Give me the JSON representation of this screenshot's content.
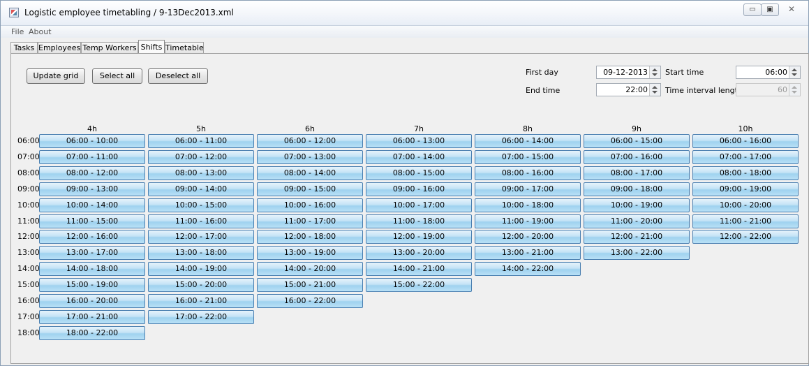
{
  "window": {
    "title": "Logistic employee timetabling / 9-13Dec2013.xml",
    "controls": {
      "minimize": "▭",
      "maximize": "▣",
      "close": "✕"
    }
  },
  "menu": {
    "file": "File",
    "about": "About"
  },
  "tabs": [
    {
      "label": "Tasks",
      "active": false
    },
    {
      "label": "Employees",
      "active": false
    },
    {
      "label": "Temp Workers",
      "active": false
    },
    {
      "label": "Shifts",
      "active": true
    },
    {
      "label": "Timetable",
      "active": false
    }
  ],
  "toolbar": {
    "update_grid": "Update grid",
    "select_all": "Select all",
    "deselect_all": "Deselect all"
  },
  "settings": {
    "first_day_label": "First day",
    "first_day_value": "09-12-2013",
    "start_time_label": "Start time",
    "start_time_value": "06:00",
    "end_time_label": "End time",
    "end_time_value": "22:00",
    "interval_label": "Time interval length",
    "interval_value": "60"
  },
  "grid": {
    "columns": [
      "4h",
      "5h",
      "6h",
      "7h",
      "8h",
      "9h",
      "10h"
    ],
    "rows": [
      "06:00",
      "07:00",
      "08:00",
      "09:00",
      "10:00",
      "11:00",
      "12:00",
      "13:00",
      "14:00",
      "15:00",
      "16:00",
      "17:00",
      "18:00"
    ],
    "cells": [
      [
        "06:00 - 10:00",
        "07:00 - 11:00",
        "08:00 - 12:00",
        "09:00 - 13:00",
        "10:00 - 14:00",
        "11:00 - 15:00",
        "12:00 - 16:00",
        "13:00 - 17:00",
        "14:00 - 18:00",
        "15:00 - 19:00",
        "16:00 - 20:00",
        "17:00 - 21:00",
        "18:00 - 22:00"
      ],
      [
        "06:00 - 11:00",
        "07:00 - 12:00",
        "08:00 - 13:00",
        "09:00 - 14:00",
        "10:00 - 15:00",
        "11:00 - 16:00",
        "12:00 - 17:00",
        "13:00 - 18:00",
        "14:00 - 19:00",
        "15:00 - 20:00",
        "16:00 - 21:00",
        "17:00 - 22:00"
      ],
      [
        "06:00 - 12:00",
        "07:00 - 13:00",
        "08:00 - 14:00",
        "09:00 - 15:00",
        "10:00 - 16:00",
        "11:00 - 17:00",
        "12:00 - 18:00",
        "13:00 - 19:00",
        "14:00 - 20:00",
        "15:00 - 21:00",
        "16:00 - 22:00"
      ],
      [
        "06:00 - 13:00",
        "07:00 - 14:00",
        "08:00 - 15:00",
        "09:00 - 16:00",
        "10:00 - 17:00",
        "11:00 - 18:00",
        "12:00 - 19:00",
        "13:00 - 20:00",
        "14:00 - 21:00",
        "15:00 - 22:00"
      ],
      [
        "06:00 - 14:00",
        "07:00 - 15:00",
        "08:00 - 16:00",
        "09:00 - 17:00",
        "10:00 - 18:00",
        "11:00 - 19:00",
        "12:00 - 20:00",
        "13:00 - 21:00",
        "14:00 - 22:00"
      ],
      [
        "06:00 - 15:00",
        "07:00 - 16:00",
        "08:00 - 17:00",
        "09:00 - 18:00",
        "10:00 - 19:00",
        "11:00 - 20:00",
        "12:00 - 21:00",
        "13:00 - 22:00"
      ],
      [
        "06:00 - 16:00",
        "07:00 - 17:00",
        "08:00 - 18:00",
        "09:00 - 19:00",
        "10:00 - 20:00",
        "11:00 - 21:00",
        "12:00 - 22:00"
      ]
    ]
  }
}
